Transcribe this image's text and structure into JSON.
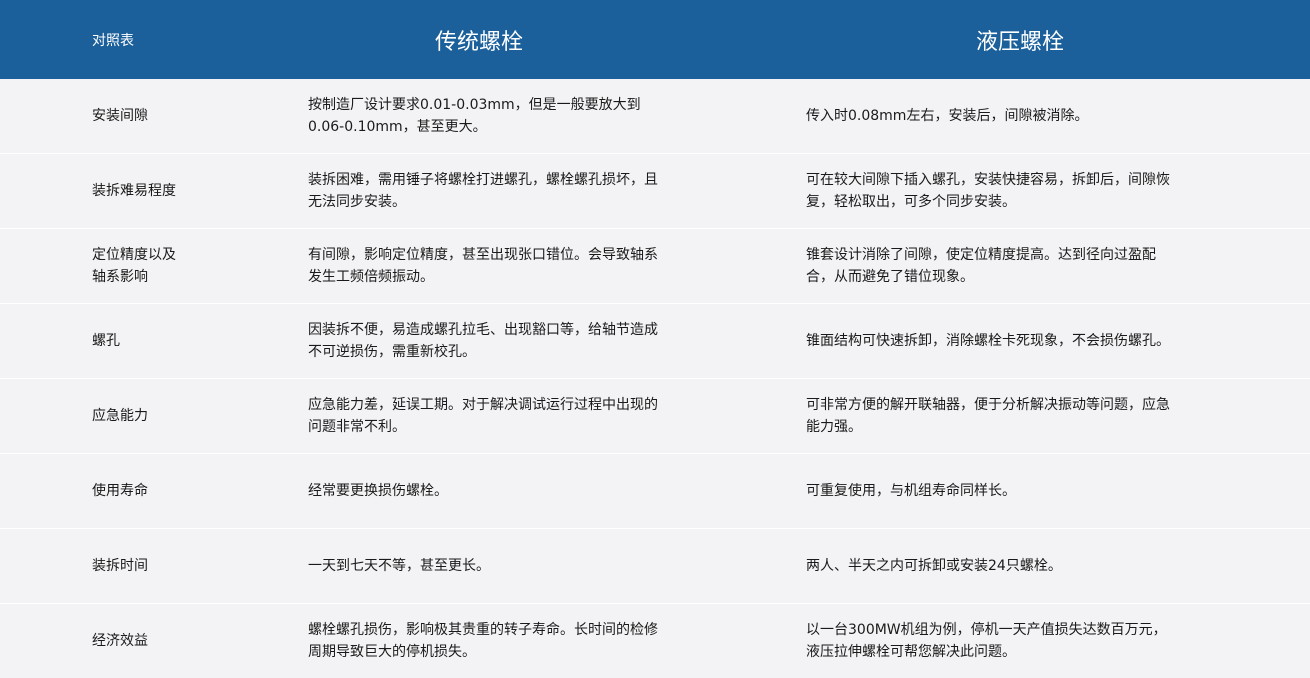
{
  "header": {
    "label": "对照表",
    "traditional": "传统螺栓",
    "hydraulic": "液压螺栓"
  },
  "rows": [
    {
      "label": "安装间隙",
      "traditional": "按制造厂设计要求0.01-0.03mm，但是一般要放大到0.06-0.10mm，甚至更大。",
      "hydraulic": "传入时0.08mm左右，安装后，间隙被消除。"
    },
    {
      "label": "装拆难易程度",
      "traditional": "装拆困难，需用锤子将螺栓打进螺孔，螺栓螺孔损坏，且无法同步安装。",
      "hydraulic": "可在较大间隙下插入螺孔，安装快捷容易，拆卸后，间隙恢复，轻松取出，可多个同步安装。"
    },
    {
      "label": "定位精度以及\n轴系影响",
      "traditional": "有间隙，影响定位精度，甚至出现张口错位。会导致轴系发生工频倍频振动。",
      "hydraulic": "锥套设计消除了间隙，使定位精度提高。达到径向过盈配合，从而避免了错位现象。"
    },
    {
      "label": "螺孔",
      "traditional": "因装拆不便，易造成螺孔拉毛、出现豁口等，给轴节造成不可逆损伤，需重新校孔。",
      "hydraulic": "锥面结构可快速拆卸，消除螺栓卡死现象，不会损伤螺孔。"
    },
    {
      "label": "应急能力",
      "traditional": "应急能力差，延误工期。对于解决调试运行过程中出现的问题非常不利。",
      "hydraulic": "可非常方便的解开联轴器，便于分析解决振动等问题，应急能力强。"
    },
    {
      "label": "使用寿命",
      "traditional": "经常要更换损伤螺栓。",
      "hydraulic": "可重复使用，与机组寿命同样长。"
    },
    {
      "label": "装拆时间",
      "traditional": "一天到七天不等，甚至更长。",
      "hydraulic": "两人、半天之内可拆卸或安装24只螺栓。"
    },
    {
      "label": "经济效益",
      "traditional": "螺栓螺孔损伤，影响极其贵重的转子寿命。长时间的检修周期导致巨大的停机损失。",
      "hydraulic": "以一台300MW机组为例，停机一天产值损失达数百万元，液压拉伸螺栓可帮您解决此问题。"
    }
  ]
}
